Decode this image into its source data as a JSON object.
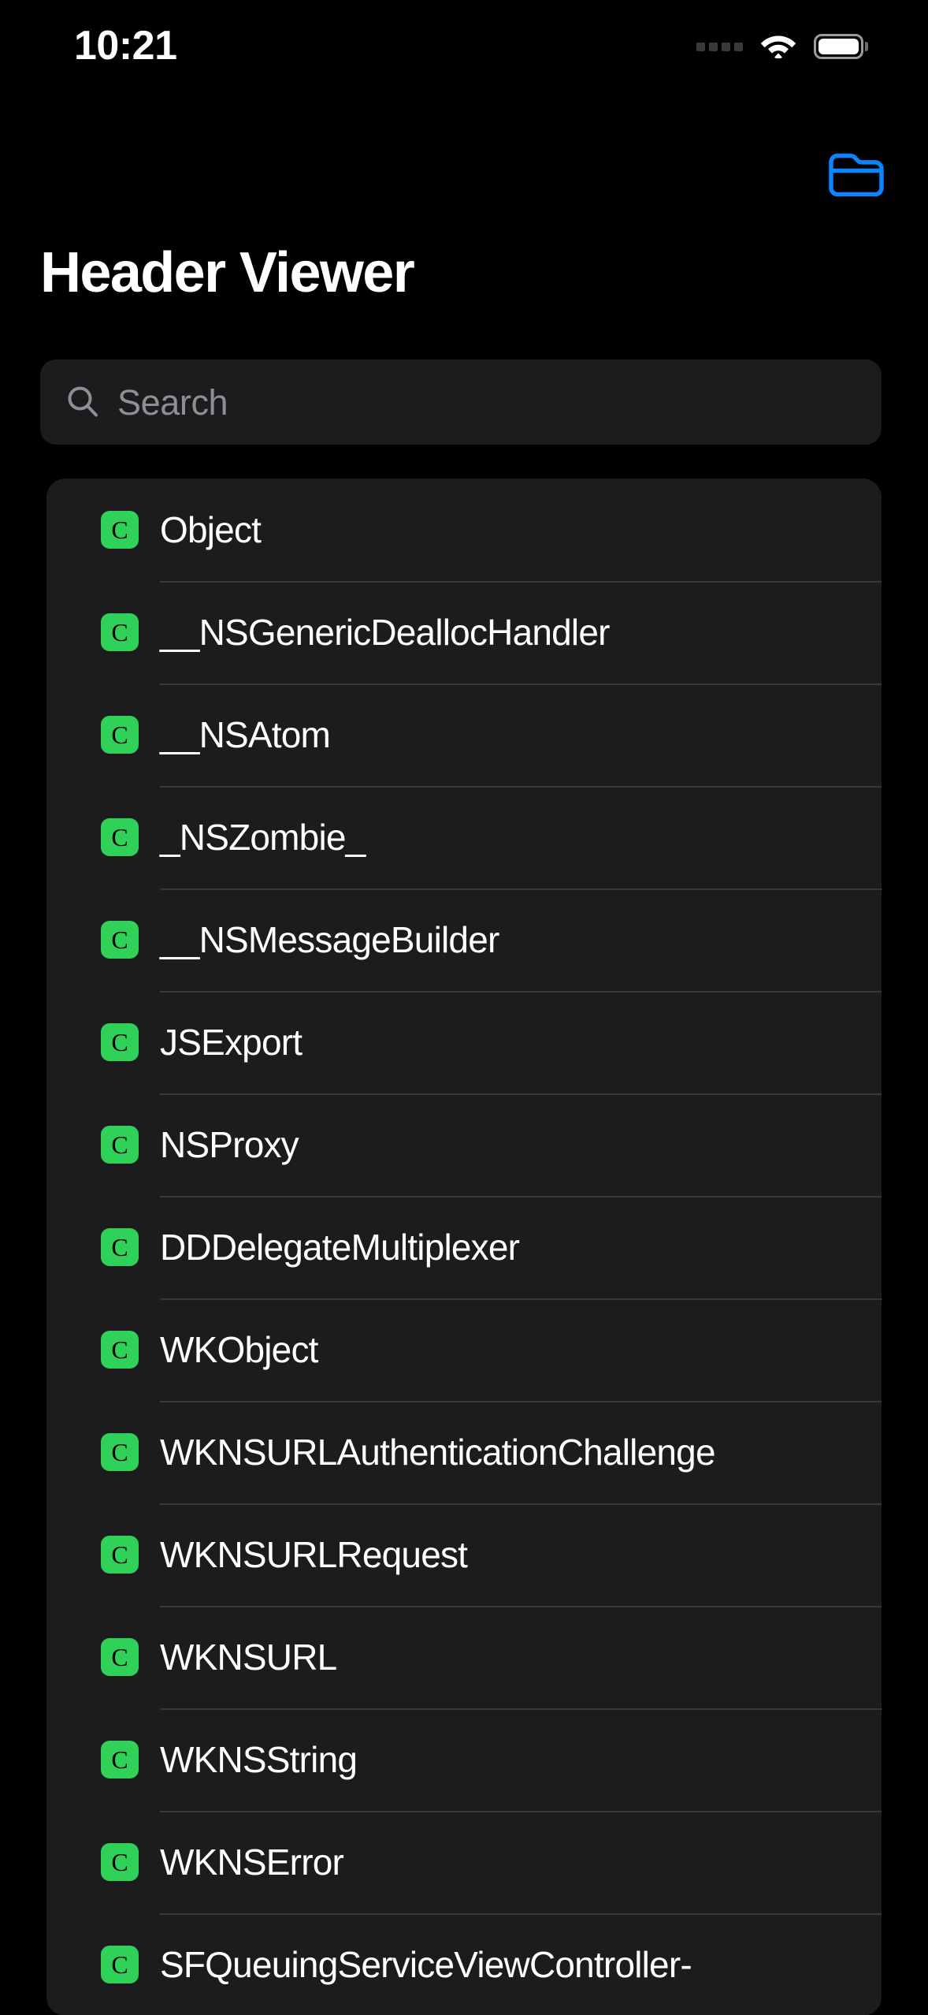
{
  "status_bar": {
    "time": "10:21",
    "signal_icon": "signal-dots-icon",
    "wifi_icon": "wifi-icon",
    "battery_icon": "battery-full-icon"
  },
  "toolbar": {
    "folder_button_icon": "folder-icon",
    "folder_button_label": "Folder",
    "accent_color": "#0a84ff"
  },
  "header": {
    "title": "Header Viewer"
  },
  "search": {
    "icon": "search-icon",
    "placeholder": "Search",
    "value": ""
  },
  "list": {
    "badge_color": "#30d158",
    "badge_letter": "C",
    "badge_meaning": "class",
    "items": [
      {
        "name": "Object",
        "kind": "C"
      },
      {
        "name": "__NSGenericDeallocHandler",
        "kind": "C"
      },
      {
        "name": "__NSAtom",
        "kind": "C"
      },
      {
        "name": "_NSZombie_",
        "kind": "C"
      },
      {
        "name": "__NSMessageBuilder",
        "kind": "C"
      },
      {
        "name": "JSExport",
        "kind": "C"
      },
      {
        "name": "NSProxy",
        "kind": "C"
      },
      {
        "name": "DDDelegateMultiplexer",
        "kind": "C"
      },
      {
        "name": "WKObject",
        "kind": "C"
      },
      {
        "name": "WKNSURLAuthenticationChallenge",
        "kind": "C"
      },
      {
        "name": "WKNSURLRequest",
        "kind": "C"
      },
      {
        "name": "WKNSURL",
        "kind": "C"
      },
      {
        "name": "WKNSString",
        "kind": "C"
      },
      {
        "name": "WKNSError",
        "kind": "C"
      },
      {
        "name": "SFQueuingServiceViewController-",
        "kind": "C"
      }
    ]
  }
}
